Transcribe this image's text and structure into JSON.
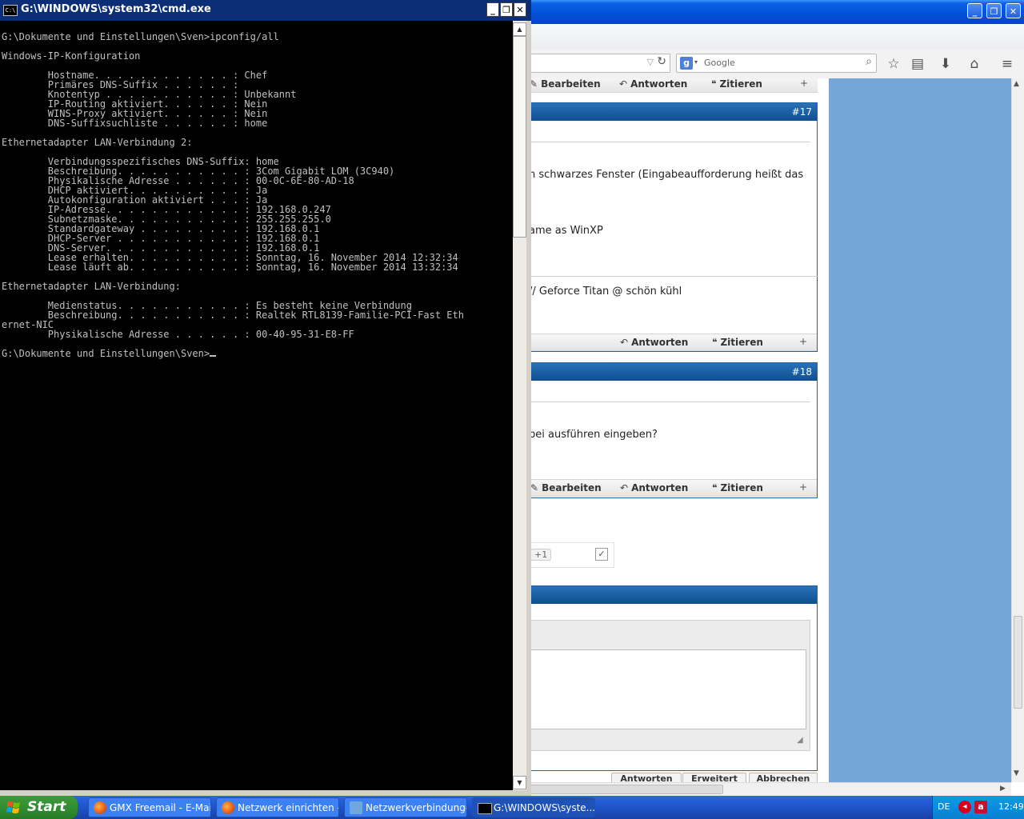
{
  "cmd": {
    "title": "G:\\WINDOWS\\system32\\cmd.exe",
    "icon": "C:\\",
    "buttons": {
      "minimize": "_",
      "maximize": "❐",
      "close": "✕"
    },
    "lines": [
      "G:\\Dokumente und Einstellungen\\Sven>ipconfig/all",
      "",
      "Windows-IP-Konfiguration",
      "",
      "        Hostname. . . . . . . . . . . . : Chef",
      "        Primäres DNS-Suffix . . . . . . : ",
      "        Knotentyp . . . . . . . . . . . : Unbekannt",
      "        IP-Routing aktiviert. . . . . . : Nein",
      "        WINS-Proxy aktiviert. . . . . . : Nein",
      "        DNS-Suffixsuchliste . . . . . . : home",
      "",
      "Ethernetadapter LAN-Verbindung 2:",
      "",
      "        Verbindungsspezifisches DNS-Suffix: home",
      "        Beschreibung. . . . . . . . . . . : 3Com Gigabit LOM (3C940)",
      "        Physikalische Adresse . . . . . . : 00-0C-6E-80-AD-18",
      "        DHCP aktiviert. . . . . . . . . . : Ja",
      "        Autokonfiguration aktiviert . . . : Ja",
      "        IP-Adresse. . . . . . . . . . . . : 192.168.0.247",
      "        Subnetzmaske. . . . . . . . . . . : 255.255.255.0",
      "        Standardgateway . . . . . . . . . : 192.168.0.1",
      "        DHCP-Server . . . . . . . . . . . : 192.168.0.1",
      "        DNS-Server. . . . . . . . . . . . : 192.168.0.1",
      "        Lease erhalten. . . . . . . . . . : Sonntag, 16. November 2014 12:32:34",
      "        Lease läuft ab. . . . . . . . . . : Sonntag, 16. November 2014 13:32:34",
      "",
      "Ethernetadapter LAN-Verbindung:",
      "",
      "        Medienstatus. . . . . . . . . . . : Es besteht keine Verbindung",
      "        Beschreibung. . . . . . . . . . . : Realtek RTL8139-Familie-PCI-Fast Eth",
      "ernet-NIC",
      "        Physikalische Adresse . . . . . . : 00-40-95-31-E8-FF",
      "",
      "G:\\Dokumente und Einstellungen\\Sven>"
    ],
    "scroll": {
      "up": "▲",
      "down": "▼"
    }
  },
  "firefox": {
    "window_buttons": {
      "minimize": "_",
      "maximize": "❐",
      "close": "✕"
    },
    "url_controls": {
      "dropdown": "▽",
      "reload": "↻"
    },
    "search": {
      "engine_icon": "g",
      "engine_dropdown": "▾",
      "placeholder": "Google",
      "icon": "⌕"
    },
    "toolbar_icons": {
      "bookmark_star": "☆",
      "reading_list": "▤",
      "downloads": "⬇",
      "home": "⌂",
      "menu": "≡"
    },
    "posts": [
      {
        "number": "#17",
        "lines": [
          "n schwarzes Fenster (Eingabeaufforderung heißt das",
          "ame as WinXP",
          "// Geforce Titan @ schön kühl"
        ],
        "buttons": {
          "reply": "Antworten",
          "quote": "Zitieren",
          "multiquote": "+"
        }
      },
      {
        "number": "#18",
        "lines": [
          "bei ausführen eingeben?"
        ],
        "buttons": {
          "edit": "Bearbeiten",
          "reply": "Antworten",
          "quote": "Zitieren",
          "multiquote": "+"
        }
      }
    ],
    "top_bar": {
      "edit": "Bearbeiten",
      "reply": "Antworten",
      "quote": "Zitieren",
      "multiquote": "+"
    },
    "gplus": "+1",
    "reply_buttons": {
      "submit": "Antworten",
      "advanced": "Erweitert",
      "cancel": "Abbrechen"
    },
    "colors": {
      "post_header": "#1f63a5",
      "sidebar": "#74a6d6"
    }
  },
  "taskbar": {
    "start": "Start",
    "tasks": [
      {
        "label": "GMX Freemail - E-Mail...",
        "active": false
      },
      {
        "label": "Netzwerk einrichten -...",
        "active": false
      },
      {
        "label": "Netzwerkverbindungen",
        "active": false
      },
      {
        "label": "G:\\WINDOWS\\syste...",
        "active": true
      }
    ],
    "language": "DE",
    "clock": "12:49"
  }
}
